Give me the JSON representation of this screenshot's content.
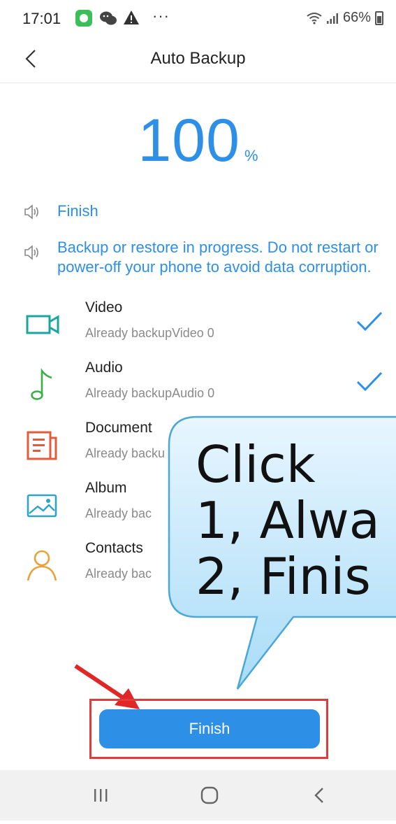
{
  "status_bar": {
    "time": "17:01",
    "battery": "66%"
  },
  "header": {
    "title": "Auto Backup"
  },
  "progress": {
    "value": "100",
    "unit": "%"
  },
  "notices": [
    {
      "text": "Finish"
    },
    {
      "text": "Backup or restore in progress. Do not restart or power-off your phone to avoid data corruption."
    }
  ],
  "items": [
    {
      "name": "Video",
      "sub": "Already backupVideo  0",
      "checked": true,
      "icon": "video-icon",
      "color": "#1ba5a0"
    },
    {
      "name": "Audio",
      "sub": "Already backupAudio  0",
      "checked": true,
      "icon": "music-note-icon",
      "color": "#3cae4a"
    },
    {
      "name": "Document",
      "sub": "Already backu",
      "checked": false,
      "icon": "document-icon",
      "color": "#e25b3b"
    },
    {
      "name": "Album",
      "sub": "Already bac",
      "checked": false,
      "icon": "album-icon",
      "color": "#2fa4c8"
    },
    {
      "name": "Contacts",
      "sub": "Already bac",
      "checked": false,
      "icon": "contacts-icon",
      "color": "#e8a23c"
    }
  ],
  "callout": {
    "line1": "Click",
    "line2": "1, Alwa",
    "line3": "2, Finis"
  },
  "finish_button": {
    "label": "Finish"
  },
  "colors": {
    "accent": "#2d8fe6",
    "highlight": "#e03c3c"
  }
}
